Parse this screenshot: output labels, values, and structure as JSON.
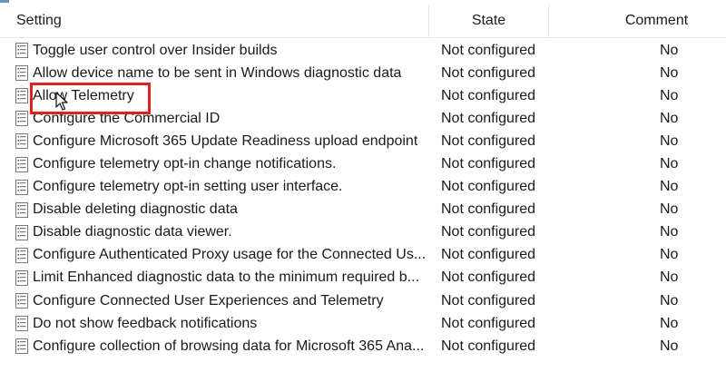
{
  "columns": {
    "setting": "Setting",
    "state": "State",
    "comment": "Comment"
  },
  "rows": [
    {
      "setting": "Toggle user control over Insider builds",
      "state": "Not configured",
      "comment": "No"
    },
    {
      "setting": "Allow device name to be sent in Windows diagnostic data",
      "state": "Not configured",
      "comment": "No"
    },
    {
      "setting": "Allow Telemetry",
      "state": "Not configured",
      "comment": "No"
    },
    {
      "setting": "Configure the Commercial ID",
      "state": "Not configured",
      "comment": "No"
    },
    {
      "setting": "Configure Microsoft 365 Update Readiness upload endpoint",
      "state": "Not configured",
      "comment": "No"
    },
    {
      "setting": "Configure telemetry opt-in change notifications.",
      "state": "Not configured",
      "comment": "No"
    },
    {
      "setting": "Configure telemetry opt-in setting user interface.",
      "state": "Not configured",
      "comment": "No"
    },
    {
      "setting": "Disable deleting diagnostic data",
      "state": "Not configured",
      "comment": "No"
    },
    {
      "setting": "Disable diagnostic data viewer.",
      "state": "Not configured",
      "comment": "No"
    },
    {
      "setting": "Configure Authenticated Proxy usage for the Connected Us...",
      "state": "Not configured",
      "comment": "No"
    },
    {
      "setting": "Limit Enhanced diagnostic data to the minimum required b...",
      "state": "Not configured",
      "comment": "No"
    },
    {
      "setting": "Configure Connected User Experiences and Telemetry",
      "state": "Not configured",
      "comment": "No"
    },
    {
      "setting": "Do not show feedback notifications",
      "state": "Not configured",
      "comment": "No"
    },
    {
      "setting": "Configure collection of browsing data for Microsoft 365 Ana...",
      "state": "Not configured",
      "comment": "No"
    }
  ],
  "highlight_color": "#e0211d",
  "row_icon": "policy-setting-icon"
}
